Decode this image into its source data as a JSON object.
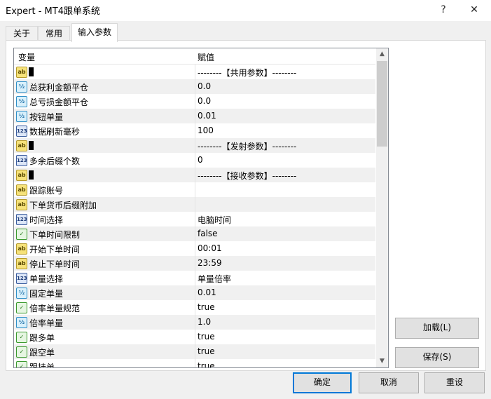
{
  "window": {
    "title": "Expert - MT4跟单系统",
    "help_label": "?",
    "close_label": "✕"
  },
  "tabs": [
    {
      "label": "关于"
    },
    {
      "label": "常用"
    },
    {
      "label": "输入参数",
      "active": true
    }
  ],
  "grid": {
    "headers": {
      "variable": "变量",
      "value": "赋值"
    },
    "rows": [
      {
        "type": "string",
        "icon_text": "ab",
        "name": "",
        "value": "--------【共用参数】--------",
        "header": true
      },
      {
        "type": "double",
        "icon_text": "½",
        "name": "总获利金额平仓",
        "value": "0.0"
      },
      {
        "type": "double",
        "icon_text": "½",
        "name": "总亏损金额平仓",
        "value": "0.0"
      },
      {
        "type": "double",
        "icon_text": "½",
        "name": "按钮单量",
        "value": "0.01"
      },
      {
        "type": "int",
        "icon_text": "123",
        "name": "数据刷新毫秒",
        "value": "100"
      },
      {
        "type": "string",
        "icon_text": "ab",
        "name": "",
        "value": "--------【发射参数】--------",
        "header": true
      },
      {
        "type": "int",
        "icon_text": "123",
        "name": "多余后缀个数",
        "value": "0"
      },
      {
        "type": "string",
        "icon_text": "ab",
        "name": "",
        "value": "--------【接收参数】--------",
        "header": true
      },
      {
        "type": "string",
        "icon_text": "ab",
        "name": "跟踪账号",
        "value": ""
      },
      {
        "type": "string",
        "icon_text": "ab",
        "name": "下单货币后缀附加",
        "value": ""
      },
      {
        "type": "int",
        "icon_text": "123",
        "name": "时间选择",
        "value": "电脑时间"
      },
      {
        "type": "bool",
        "icon_text": "✓",
        "name": "下单时间限制",
        "value": "false"
      },
      {
        "type": "string",
        "icon_text": "ab",
        "name": "开始下单时间",
        "value": "00:01"
      },
      {
        "type": "string",
        "icon_text": "ab",
        "name": "停止下单时间",
        "value": "23:59"
      },
      {
        "type": "int",
        "icon_text": "123",
        "name": "单量选择",
        "value": "单量倍率"
      },
      {
        "type": "double",
        "icon_text": "½",
        "name": "固定单量",
        "value": "0.01"
      },
      {
        "type": "bool",
        "icon_text": "✓",
        "name": "倍率单量规范",
        "value": "true"
      },
      {
        "type": "double",
        "icon_text": "½",
        "name": "倍率单量",
        "value": "1.0"
      },
      {
        "type": "bool",
        "icon_text": "✓",
        "name": "跟多单",
        "value": "true"
      },
      {
        "type": "bool",
        "icon_text": "✓",
        "name": "跟空单",
        "value": "true"
      },
      {
        "type": "bool",
        "icon_text": "✓",
        "name": "跟挂单",
        "value": "true"
      }
    ]
  },
  "side_buttons": {
    "load": "加载(L)",
    "save": "保存(S)"
  },
  "footer_buttons": {
    "ok": "确定",
    "cancel": "取消",
    "reset": "重设"
  },
  "scrollbar": {
    "up_icon": "▲",
    "down_icon": "▼"
  }
}
